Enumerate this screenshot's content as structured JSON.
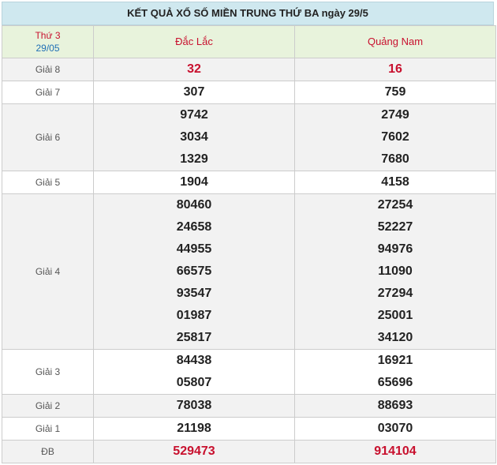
{
  "title": "KẾT QUẢ XỔ SỐ MIỀN TRUNG THỨ BA ngày 29/5",
  "header": {
    "day_label": "Thứ 3",
    "date_label": "29/05",
    "province_a": "Đắc Lắc",
    "province_b": "Quảng Nam"
  },
  "prizes": [
    {
      "label": "Giải 8",
      "a": [
        "32"
      ],
      "b": [
        "16"
      ]
    },
    {
      "label": "Giải 7",
      "a": [
        "307"
      ],
      "b": [
        "759"
      ]
    },
    {
      "label": "Giải 6",
      "a": [
        "9742",
        "3034",
        "1329"
      ],
      "b": [
        "2749",
        "7602",
        "7680"
      ]
    },
    {
      "label": "Giải 5",
      "a": [
        "1904"
      ],
      "b": [
        "4158"
      ]
    },
    {
      "label": "Giải 4",
      "a": [
        "80460",
        "24658",
        "44955",
        "66575",
        "93547",
        "01987",
        "25817"
      ],
      "b": [
        "27254",
        "52227",
        "94976",
        "11090",
        "27294",
        "25001",
        "34120"
      ]
    },
    {
      "label": "Giải 3",
      "a": [
        "84438",
        "05807"
      ],
      "b": [
        "16921",
        "65696"
      ]
    },
    {
      "label": "Giải 2",
      "a": [
        "78038"
      ],
      "b": [
        "88693"
      ]
    },
    {
      "label": "Giải 1",
      "a": [
        "21198"
      ],
      "b": [
        "03070"
      ]
    },
    {
      "label": "ĐB",
      "a": [
        "529473"
      ],
      "b": [
        "914104"
      ]
    }
  ],
  "colors": {
    "accent_red": "#c8102e",
    "date_blue": "#1f6fb5",
    "title_bg": "#cfe8ef",
    "header_bg": "#e8f3dc",
    "row_shade": "#f2f2f2"
  }
}
